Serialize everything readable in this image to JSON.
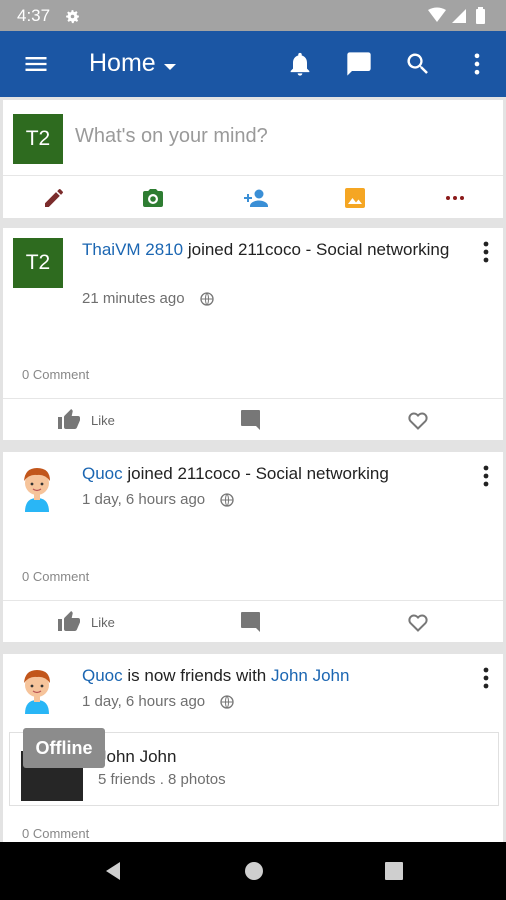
{
  "status_bar": {
    "time": "4:37"
  },
  "app_bar": {
    "title": "Home"
  },
  "composer": {
    "avatar_initials": "T2",
    "placeholder": "What's on your mind?"
  },
  "posts": [
    {
      "avatar_initials": "T2",
      "author": "ThaiVM 2810",
      "action": " joined 211coco - Social networking",
      "time": "21 minutes ago",
      "comments": "0 Comment",
      "like_label": "Like"
    },
    {
      "author": "Quoc",
      "action": " joined 211coco - Social networking",
      "time": "1 day, 6 hours ago",
      "comments": "0 Comment",
      "like_label": "Like"
    },
    {
      "author": "Quoc",
      "action": " is now friends with ",
      "target": "John John",
      "time": "1 day, 6 hours ago",
      "friend": {
        "name": "John John",
        "meta": "5 friends . 8 photos"
      },
      "comments": "0 Comment"
    }
  ],
  "offline_badge": "Offline",
  "colors": {
    "app_bar": "#1b56a4",
    "link": "#1b66b2",
    "avatar_bg": "#2e6b1f"
  }
}
